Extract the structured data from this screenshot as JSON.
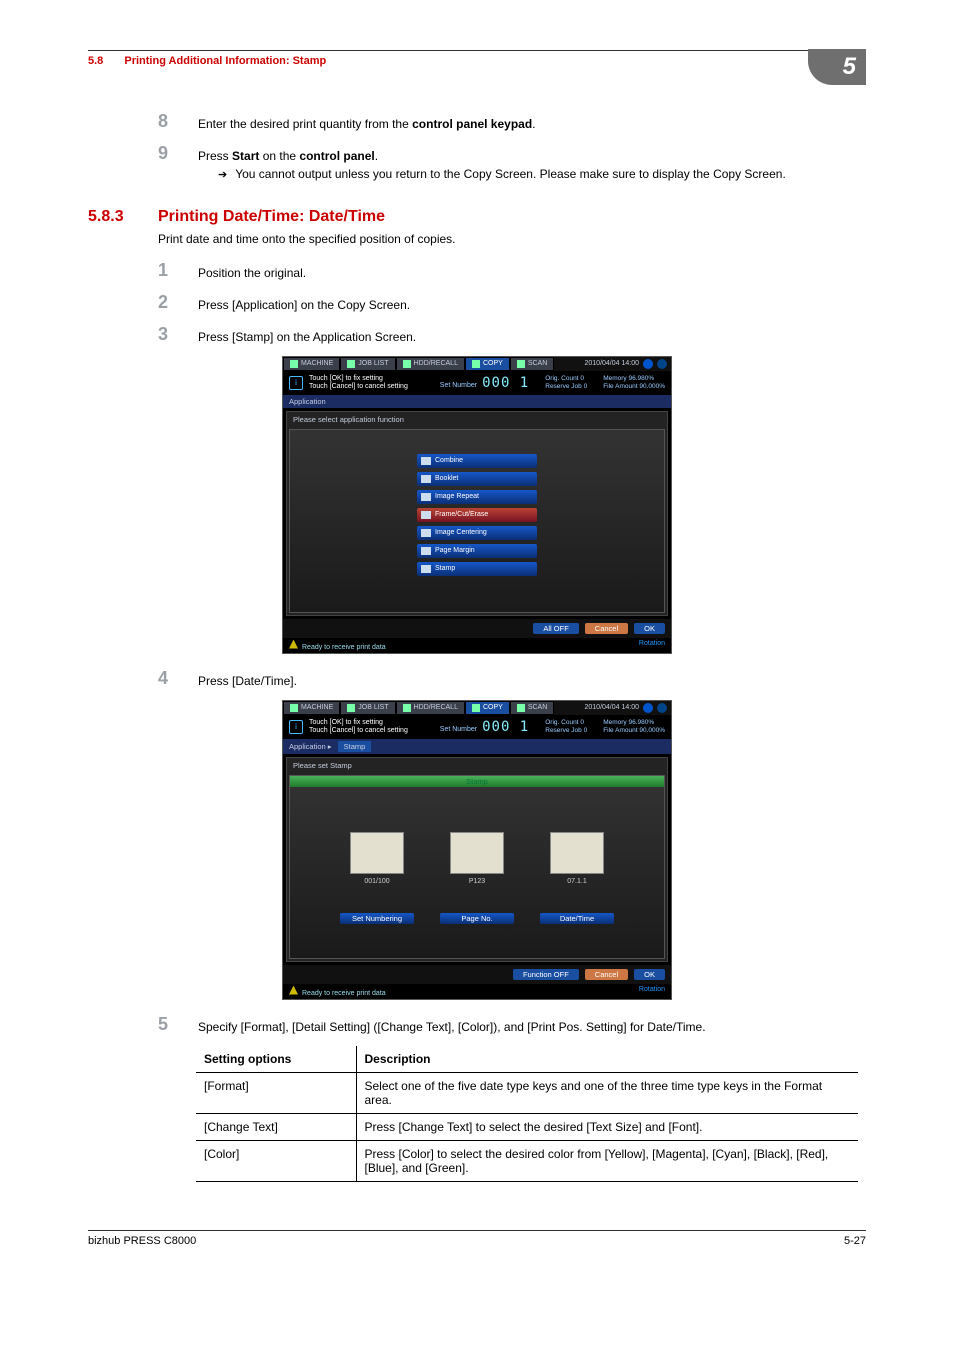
{
  "header": {
    "section_num": "5.8",
    "section_title": "Printing Additional Information: Stamp",
    "chapter_tab": "5"
  },
  "pre_steps": [
    {
      "n": "8",
      "html": "Enter the desired print quantity from the <b>control panel keypad</b>."
    },
    {
      "n": "9",
      "html": "Press <b>Start</b> on the <b>control panel</b>.",
      "arrow": "You cannot output unless you return to the Copy Screen. Please make sure to display the Copy Screen."
    }
  ],
  "subsection": {
    "num": "5.8.3",
    "title": "Printing Date/Time: Date/Time"
  },
  "intro": "Print date and time onto the specified position of copies.",
  "steps_a": [
    {
      "n": "1",
      "html": "Position the original."
    },
    {
      "n": "2",
      "html": "Press [Application] on the Copy Screen."
    },
    {
      "n": "3",
      "html": "Press [Stamp] on the Application Screen."
    }
  ],
  "steps_b": [
    {
      "n": "4",
      "html": "Press [Date/Time]."
    }
  ],
  "steps_c": [
    {
      "n": "5",
      "html": "Specify [Format], [Detail Setting] ([Change Text], [Color]), and [Print Pos. Setting] for Date/Time."
    }
  ],
  "screenshot_common": {
    "tabs": {
      "machine": "MACHINE",
      "joblist": "JOB LIST",
      "recall": "HDD/RECALL",
      "copy": "COPY",
      "scan": "SCAN"
    },
    "timestamp": "2010/04/04 14:00",
    "info1": "Touch [OK] to fix setting",
    "info2": "Touch [Cancel] to cancel setting",
    "setnum_label": "Set Number",
    "setnum_value": "000 1",
    "orig_count": "Orig. Count",
    "orig_count_v": "0",
    "reserve": "Reserve Job",
    "reserve_v": "0",
    "memory": "Memory",
    "memory_v": "96.980%",
    "file_amount": "File Amount",
    "file_amount_v": "90.000%",
    "status": "Ready to receive print data",
    "rotation": "Rotation",
    "btn_alloff": "All OFF",
    "btn_cancel": "Cancel",
    "btn_ok": "OK",
    "btn_funcoff": "Function OFF"
  },
  "screenshot1": {
    "crumb": "Application",
    "panel_title": "Please select application function",
    "buttons": [
      "Combine",
      "Booklet",
      "Image Repeat",
      "Frame/Cut/Erase",
      "Image Centering",
      "Page Margin",
      "Stamp"
    ]
  },
  "screenshot2": {
    "crumb1": "Application",
    "crumb2": "Stamp",
    "panel_title": "Please set Stamp",
    "stamp_bar": "Stamp",
    "cards": [
      {
        "label": "001/100",
        "btn": "Set Numbering"
      },
      {
        "label": "P123",
        "btn": "Page No."
      },
      {
        "label": "07.1.1",
        "btn": "Date/Time"
      }
    ]
  },
  "table": {
    "head": [
      "Setting options",
      "Description"
    ],
    "rows": [
      [
        "[Format]",
        "Select one of the five date type keys and one of the three time type keys in the Format area."
      ],
      [
        "[Change Text]",
        "Press [Change Text] to select the desired [Text Size] and [Font]."
      ],
      [
        "[Color]",
        "Press [Color] to select the desired color from [Yellow], [Magenta], [Cyan], [Black], [Red], [Blue], and [Green]."
      ]
    ]
  },
  "footer": {
    "left": "bizhub PRESS C8000",
    "right": "5-27"
  }
}
